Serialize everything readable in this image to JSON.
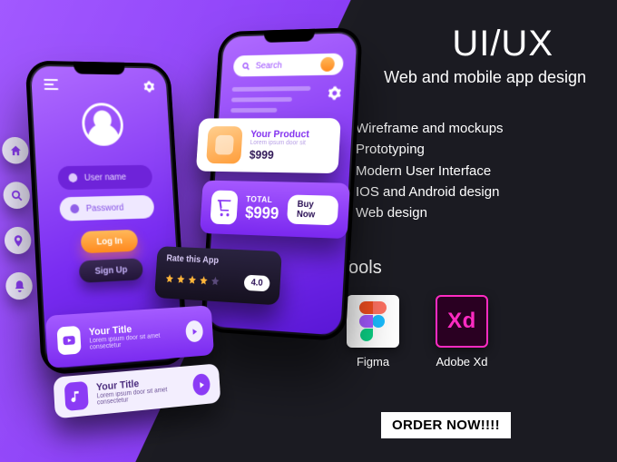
{
  "headline": "UI/UX",
  "subhead": "Web and mobile app design",
  "bullets": [
    "Wireframe and mockups",
    "Prototyping",
    "Modern User Interface",
    "IOS and Android design",
    "Web design"
  ],
  "tools_heading": "Tools",
  "tools": {
    "figma": "Figma",
    "xd_label": "Adobe Xd",
    "xd_mark": "Xd"
  },
  "cta": "ORDER NOW!!!!",
  "phone1": {
    "username_placeholder": "User name",
    "password_placeholder": "Password",
    "login": "Log In",
    "signup": "Sign Up"
  },
  "phone2": {
    "search_placeholder": "Search"
  },
  "product": {
    "title": "Your Product",
    "sub": "Lorem ipsum door sit",
    "price": "$999"
  },
  "total": {
    "label": "TOTAL",
    "price": "$999",
    "buy": "Buy Now"
  },
  "rating": {
    "title": "Rate this App",
    "score": "4.0"
  },
  "card_title": {
    "title": "Your Title",
    "sub": "Lorem ipsum door sit amet consectetur"
  }
}
